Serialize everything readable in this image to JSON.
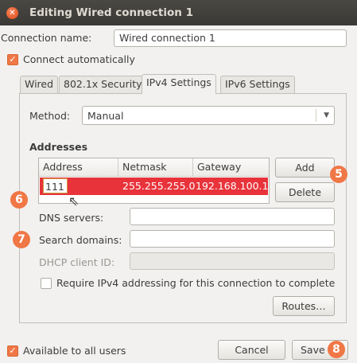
{
  "window": {
    "title": "Editing Wired connection 1"
  },
  "connection": {
    "name_label": "Connection name:",
    "name_value": "Wired connection 1",
    "auto_label": "Connect automatically",
    "auto_checked": true
  },
  "tabs": [
    {
      "label": "Wired"
    },
    {
      "label": "802.1x Security"
    },
    {
      "label": "IPv4 Settings",
      "active": true
    },
    {
      "label": "IPv6 Settings"
    }
  ],
  "ipv4": {
    "method_label": "Method:",
    "method_value": "Manual",
    "addresses_heading": "Addresses",
    "columns": [
      "Address",
      "Netmask",
      "Gateway"
    ],
    "rows": [
      {
        "address": "111",
        "netmask": "255.255.255.0",
        "gateway": "192.168.100.1"
      }
    ],
    "add_label": "Add",
    "delete_label": "Delete",
    "dns_label": "DNS servers:",
    "dns_value": "",
    "search_label": "Search domains:",
    "search_value": "",
    "dhcp_label": "DHCP client ID:",
    "dhcp_value": "",
    "require_label": "Require IPv4 addressing for this connection to complete",
    "routes_label": "Routes…"
  },
  "footer": {
    "available_label": "Available to all users",
    "cancel_label": "Cancel",
    "save_label": "Save"
  },
  "badges": {
    "b5": "5",
    "b6": "6",
    "b7": "7",
    "b8": "8"
  },
  "colors": {
    "accent": "#f07746",
    "selection": "#e8333a",
    "titlebar": "#3b3935"
  },
  "icons": {
    "close": "close-icon",
    "dropdown": "chevron-down-icon",
    "cursor": "mouse-cursor-icon"
  }
}
